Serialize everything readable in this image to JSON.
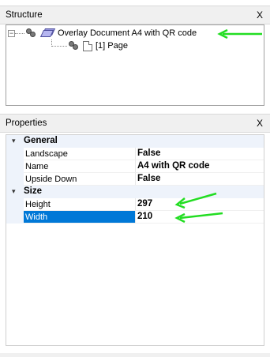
{
  "structure_panel": {
    "title": "Structure",
    "close_label": "X",
    "tree": {
      "root": {
        "expander": "−",
        "label": "Overlay Document A4 with QR code"
      },
      "child": {
        "label": "[1] Page"
      }
    }
  },
  "properties_panel": {
    "title": "Properties",
    "close_label": "X",
    "categories": [
      {
        "toggle": "▾",
        "name": "General",
        "rows": [
          {
            "name": "Landscape",
            "value": "False"
          },
          {
            "name": "Name",
            "value": "A4 with QR code"
          },
          {
            "name": "Upside Down",
            "value": "False"
          }
        ]
      },
      {
        "toggle": "▾",
        "name": "Size",
        "rows": [
          {
            "name": "Height",
            "value": "297"
          },
          {
            "name": "Width",
            "value": "210",
            "selected": true
          }
        ]
      }
    ]
  },
  "colors": {
    "annotation_arrow": "#22dd22",
    "selection": "#0078d7",
    "category_band": "#eef3fb",
    "panel_header": "#f0f0f0"
  },
  "icons": {
    "root_node": [
      "film-reel-icon",
      "document-stack-icon"
    ],
    "child_node": [
      "film-reel-icon",
      "page-icon"
    ]
  }
}
